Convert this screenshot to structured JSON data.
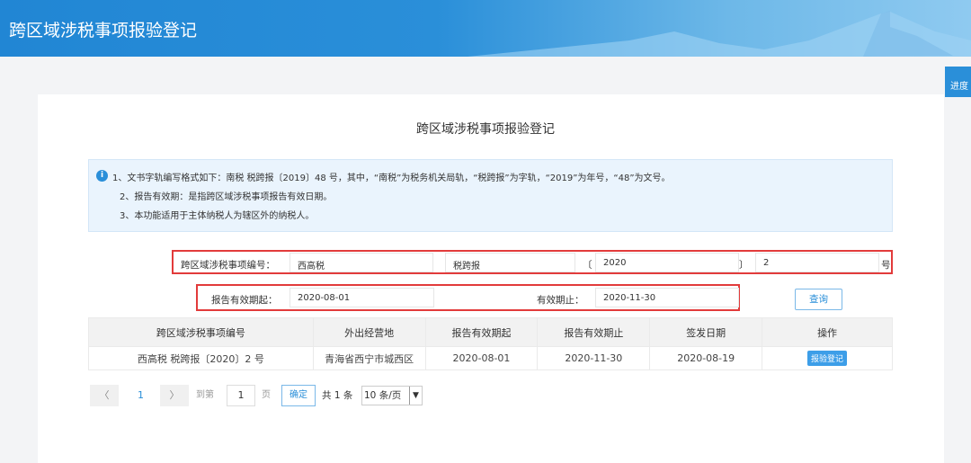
{
  "header": {
    "title": "跨区域涉税事项报验登记"
  },
  "side_tab": {
    "label": "进度"
  },
  "page_title": "跨区域涉税事项报验登记",
  "info": {
    "lines": [
      "1、文书字轨编写格式如下：南税 税跨报〔2019〕48 号，其中，“南税”为税务机关局轨，“税跨报”为字轨，“2019”为年号，“48”为文号。",
      "2、报告有效期：是指跨区域涉税事项报告有效日期。",
      "3、本功能适用于主体纳税人为辖区外的纳税人。"
    ]
  },
  "form": {
    "code_label": "跨区域涉税事项编号：",
    "code_prefix": "西高税",
    "code_word": "税跨报",
    "bracket_open": "〔",
    "code_year": "2020",
    "bracket_close": "〕",
    "code_number": "2",
    "code_suffix": "号",
    "start_label": "报告有效期起：",
    "start_value": "2020-08-01",
    "end_label": "有效期止：",
    "end_value": "2020-11-30",
    "query_button": "查询"
  },
  "table": {
    "headers": [
      "跨区域涉税事项编号",
      "外出经营地",
      "报告有效期起",
      "报告有效期止",
      "签发日期",
      "操作"
    ],
    "rows": [
      {
        "code": "西高税 税跨报〔2020〕2 号",
        "place": "青海省西宁市城西区",
        "start": "2020-08-01",
        "end": "2020-11-30",
        "issue": "2020-08-19",
        "action": "报验登记"
      }
    ]
  },
  "pagination": {
    "prev": "〈",
    "current": "1",
    "next": "〉",
    "goto_label": "到第",
    "goto_value": "1",
    "page_unit": "页",
    "confirm": "确定",
    "total": "共 1 条",
    "page_size": "10 条/页"
  },
  "colors": {
    "header": "#2a8fd9",
    "highlight_border": "#e23b3b",
    "info_bg": "#eaf4fd"
  }
}
